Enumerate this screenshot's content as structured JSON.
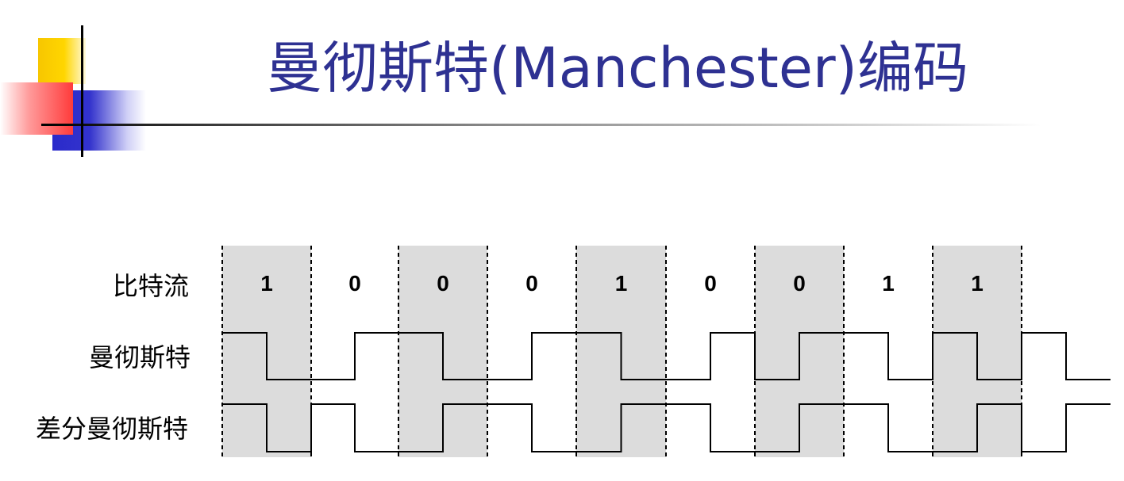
{
  "title": "曼彻斯特(Manchester)编码",
  "row_labels": {
    "bitstream": "比特流",
    "manchester": "曼彻斯特",
    "diff_manchester": "差分曼彻斯特"
  },
  "bits": [
    "1",
    "0",
    "0",
    "0",
    "1",
    "0",
    "0",
    "1",
    "1"
  ],
  "colors": {
    "title": "#2e3192",
    "shading": "#dcdcdc",
    "signal": "#000000"
  },
  "manchester_levels": [
    [
      1,
      0
    ],
    [
      0,
      1
    ],
    [
      1,
      0
    ],
    [
      0,
      1
    ],
    [
      1,
      0
    ],
    [
      0,
      1
    ],
    [
      0,
      1
    ],
    [
      1,
      0
    ],
    [
      1,
      0
    ],
    [
      1,
      0
    ]
  ],
  "diff_manchester_levels": [
    [
      1,
      0
    ],
    [
      1,
      0
    ],
    [
      0,
      1
    ],
    [
      1,
      0
    ],
    [
      0,
      1
    ],
    [
      1,
      0
    ],
    [
      0,
      1
    ],
    [
      1,
      0
    ],
    [
      0,
      1
    ],
    [
      0,
      1
    ]
  ]
}
